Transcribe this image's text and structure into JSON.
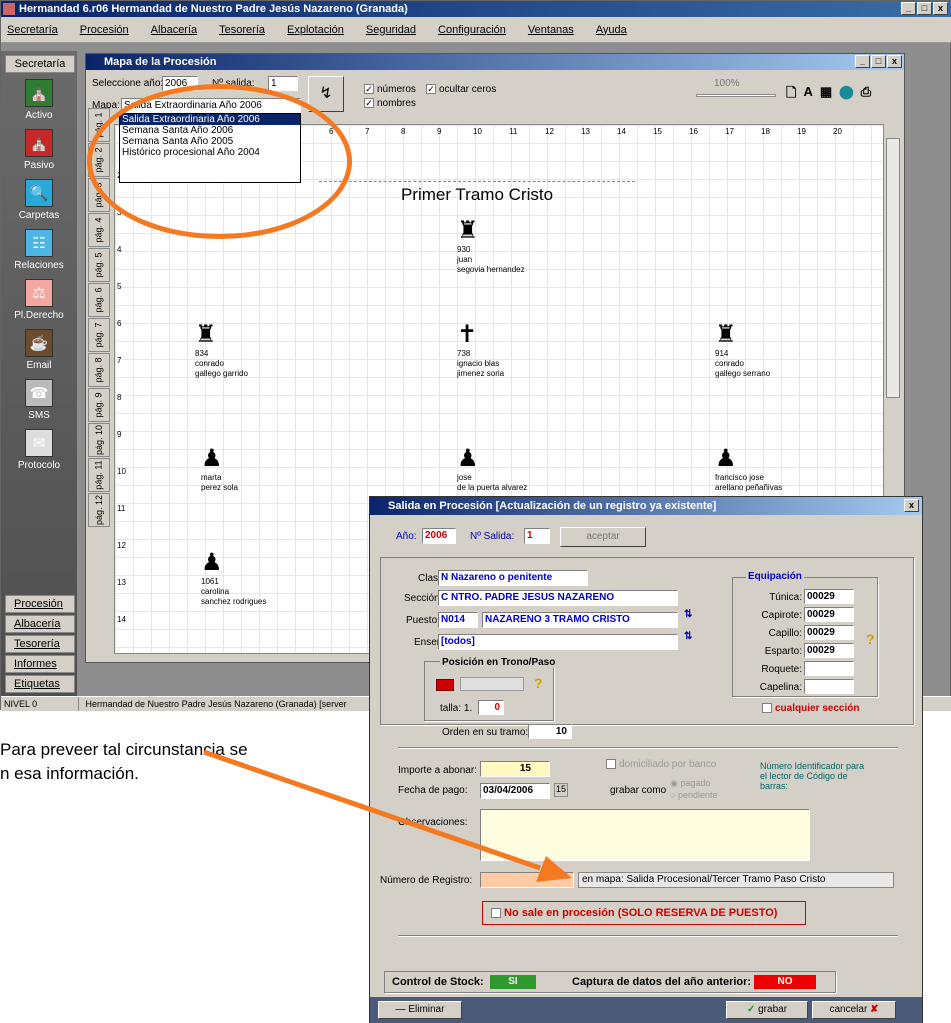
{
  "app": {
    "title": "Hermandad 6.r06  Hermandad de Nuestro Padre Jesús Nazareno (Granada)",
    "win_buttons": [
      "_",
      "□",
      "x"
    ]
  },
  "menu": [
    "Secretaría",
    "Procesión",
    "Albacería",
    "Tesorería",
    "Explotación",
    "Seguridad",
    "Configuración",
    "Ventanas",
    "Ayuda"
  ],
  "sidebar": {
    "top": "Secretaría",
    "items": [
      {
        "label": "Activo",
        "icon": "nazareno-icon"
      },
      {
        "label": "Pasivo",
        "icon": "nazareno-icon"
      },
      {
        "label": "Carpetas",
        "icon": "magnifier-icon"
      },
      {
        "label": "Relaciones",
        "icon": "tree-icon"
      },
      {
        "label": "Pl.Derecho",
        "icon": "gavel-icon"
      },
      {
        "label": "Email",
        "icon": "coffee-icon"
      },
      {
        "label": "SMS",
        "icon": "phone-icon"
      },
      {
        "label": "Protocolo",
        "icon": "envelope-icon"
      }
    ],
    "bottom": [
      "Procesión",
      "Albacería",
      "Tesorería",
      "Informes",
      "Etiquetas"
    ]
  },
  "status": {
    "level": "NIVEL 0",
    "text": "Hermandad de Nuestro Padre Jesús Nazareno (Granada) [server"
  },
  "map": {
    "title": "Mapa de la Procesión",
    "year_label": "Seleccione año:",
    "year": "2006",
    "salida_label": "Nº salida:",
    "salida": "1",
    "mapa_label": "Mapa:",
    "mapa_value": "Salida Extraordinaria Año 2006",
    "options": [
      "Salida Extraordinaria Año 2006",
      "Semana Santa Año 2006",
      "Semana Santa Año 2005",
      "Histórico procesional Año 2004"
    ],
    "checks": [
      {
        "label": "números",
        "checked": true
      },
      {
        "label": "ocultar ceros",
        "checked": true
      },
      {
        "label": "nombres",
        "checked": true
      }
    ],
    "zoom": "100%",
    "tool_icons": [
      "page-icon",
      "font-icon",
      "export-icon",
      "db-icon",
      "print-icon"
    ],
    "page_tabs": [
      "pág. 1",
      "pág. 2",
      "pág. 3",
      "pág. 4",
      "pág. 5",
      "pág. 6",
      "pág. 7",
      "pág. 8",
      "pág. 9",
      "pág. 10",
      "pág. 11",
      "pág. 12"
    ],
    "col_numbers": [
      "6",
      "7",
      "8",
      "9",
      "10",
      "11",
      "12",
      "13",
      "14",
      "15",
      "16",
      "17",
      "18",
      "19",
      "20"
    ],
    "row_numbers": [
      "2",
      "3",
      "4",
      "5",
      "6",
      "7",
      "8",
      "9",
      "10",
      "11",
      "12",
      "13",
      "14"
    ],
    "section_title": "Primer Tramo Cristo",
    "people": [
      {
        "num": "930",
        "name": "juan",
        "surname": "segovia hernandez"
      },
      {
        "num": "834",
        "name": "conrado",
        "surname": "gallego garrido"
      },
      {
        "num": "738",
        "name": "ignacio blas",
        "surname": "jimenez soria"
      },
      {
        "num": "914",
        "name": "conrado",
        "surname": "gallego serrano"
      },
      {
        "num": "",
        "name": "marta",
        "surname": "perez sola"
      },
      {
        "num": "",
        "name": "jose",
        "surname": "de la puerta alvarez"
      },
      {
        "num": "",
        "name": "francisco jose",
        "surname": "arellano peñañivas"
      },
      {
        "num": "1061",
        "name": "carolina",
        "surname": "sanchez rodrigues"
      }
    ]
  },
  "dialog": {
    "title": "Salida en Procesión [Actualización de un registro ya existente]",
    "anio_label": "Año:",
    "anio": "2006",
    "salida_label": "Nº Salida:",
    "salida": "1",
    "aceptar": "aceptar",
    "clase_label": "Clase:",
    "clase": "N  Nazareno o penitente",
    "seccion_label": "Sección:",
    "seccion": "C  NTRO. PADRE JESUS NAZARENO",
    "puesto_label": "Puesto:",
    "puesto_code": "N014",
    "puesto": "NAZARENO 3 TRAMO CRISTO",
    "enser_label": "Enser:",
    "enser": "[todos]",
    "posicion_title": "Posición en Trono/Paso",
    "talla_label": "talla: 1.",
    "talla": "0",
    "orden_label": "Orden en su tramo:",
    "orden": "10",
    "equipacion_title": "Equipación",
    "equipacion": [
      {
        "label": "Túnica:",
        "value": "00029"
      },
      {
        "label": "Capirote:",
        "value": "00029"
      },
      {
        "label": "Capillo:",
        "value": "00029"
      },
      {
        "label": "Esparto:",
        "value": "00029"
      },
      {
        "label": "Roquete:",
        "value": ""
      },
      {
        "label": "Capelina:",
        "value": ""
      }
    ],
    "cualquier": "cualquier sección",
    "importe_label": "Importe a abonar:",
    "importe": "15",
    "fecha_label": "Fecha de pago:",
    "fecha": "03/04/2006",
    "domiciliado": "domiciliado por banco",
    "grabar_como": "grabar como",
    "pagado": "pagado",
    "pendiente": "pendiente",
    "barcode_text": "Número Identificador para el lector de Código de barras:",
    "obs_label": "Observaciones:",
    "registro_label": "Número de Registro:",
    "en_mapa": "en mapa: Salida Procesional/Tercer Tramo Paso Cristo",
    "no_sale": "No sale en procesión (SOLO RESERVA DE PUESTO)",
    "stock_label": "Control de Stock:",
    "stock": "SI",
    "captura_label": "Captura de datos del año anterior:",
    "captura": "NO",
    "eliminar": "Eliminar",
    "grabar": "grabar",
    "cancelar": "cancelar"
  },
  "doc_text": [
    "Para preveer tal circunstancia se",
    "n esa información."
  ],
  "colors": {
    "highlight": "#f47920",
    "title_blue": "#0a246a",
    "dialog_band": "#4a5a78"
  }
}
